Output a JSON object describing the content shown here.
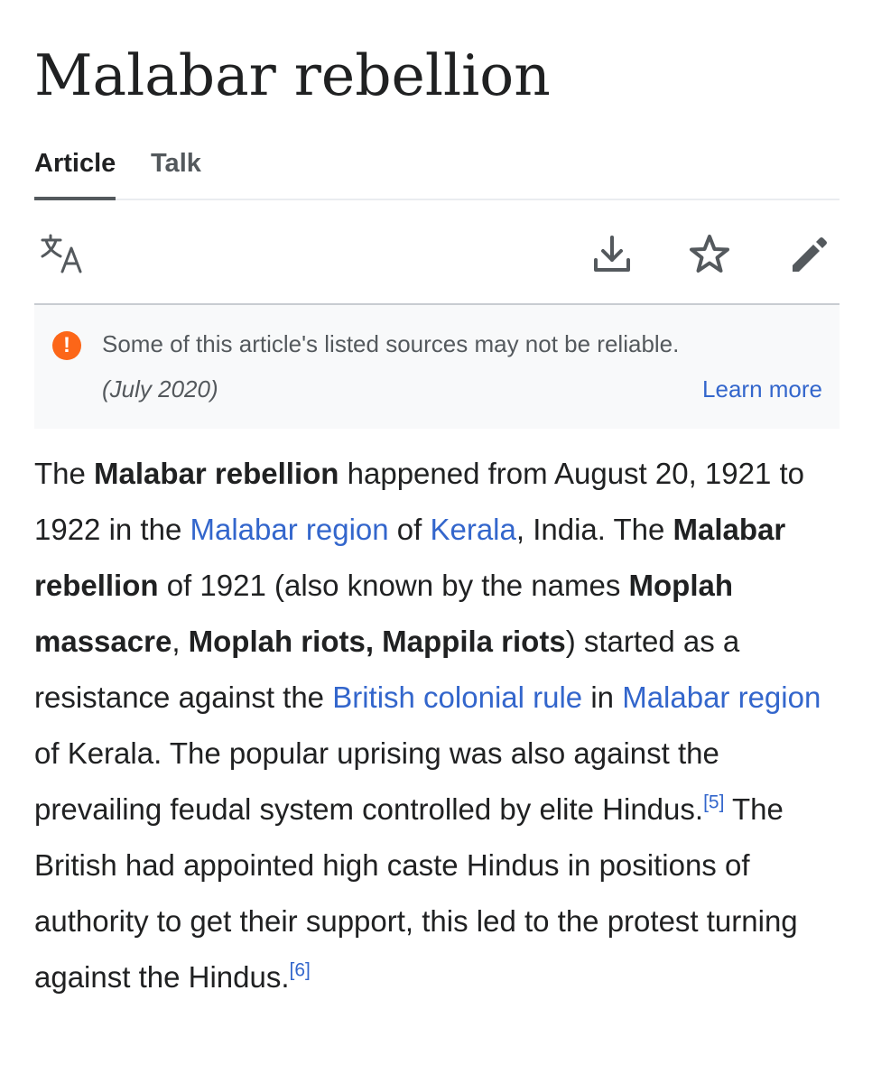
{
  "page": {
    "title": "Malabar rebellion"
  },
  "tabs": [
    {
      "label": "Article",
      "active": true
    },
    {
      "label": "Talk",
      "active": false
    }
  ],
  "toolbar": {
    "icons": [
      "language-icon",
      "download-icon",
      "star-icon",
      "pencil-icon"
    ]
  },
  "notice": {
    "icon": "exclamation-icon",
    "text": "Some of this article's listed sources may not be reliable.",
    "date": "(July 2020)",
    "learn_more": "Learn more"
  },
  "article": {
    "s1_the": "The ",
    "s1_bold": "Malabar rebellion",
    "s1_rest": " happened from August 20, 1921 to 1922 in the ",
    "link_malabar_region": "Malabar region",
    "s1_of": " of ",
    "link_kerala": "Kerala",
    "s1_end": ", India.",
    "s2_the": " The ",
    "s2_bold": "Malabar rebellion",
    "s2_rest": " of 1921 (also known by the names ",
    "name_moplah_massacre": "Moplah massacre",
    "comma1": ", ",
    "name_moplah_riots": "Moplah riots, Mappila riots",
    "s2_rest2": ") started as a resistance against the ",
    "link_british_colonial_rule": "British colonial rule",
    "s2_in": " in ",
    "link_malabar_region_2": "Malabar region",
    "s2_end": " of Kerala. The popular uprising was also against the prevailing feudal system controlled by elite Hindus.",
    "ref_5": "[5]",
    "s3": " The British had appointed high caste Hindus in positions of authority to get their support, this led to the protest turning against the Hindus.",
    "ref_6": "[6]"
  },
  "colors": {
    "link": "#3366cc",
    "text": "#202122",
    "notice_icon": "#fc6618",
    "notice_bg": "#f8f9fa",
    "tab_underline": "#54595d"
  }
}
